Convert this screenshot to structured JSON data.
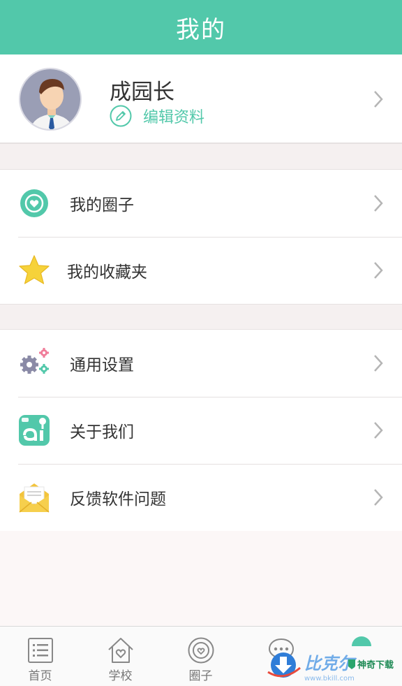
{
  "header": {
    "title": "我的"
  },
  "profile": {
    "name": "成园长",
    "edit_label": "编辑资料"
  },
  "menu_group_1": [
    {
      "label": "我的圈子",
      "icon": "circle-heart-icon"
    },
    {
      "label": "我的收藏夹",
      "icon": "star-icon"
    }
  ],
  "menu_group_2": [
    {
      "label": "通用设置",
      "icon": "gears-icon"
    },
    {
      "label": "关于我们",
      "icon": "app-logo-icon"
    },
    {
      "label": "反馈软件问题",
      "icon": "envelope-icon"
    }
  ],
  "tabbar": {
    "tabs": [
      {
        "label": "首页",
        "icon": "list-icon"
      },
      {
        "label": "学校",
        "icon": "house-heart-icon"
      },
      {
        "label": "圈子",
        "icon": "circle-heart-icon"
      },
      {
        "label": "",
        "icon": "chat-bubble-icon"
      },
      {
        "label": "",
        "icon": "profile-icon"
      }
    ]
  },
  "watermark": {
    "text": "比克尔",
    "url_text": "www.bkill.com",
    "brand": "神奇下载"
  },
  "colors": {
    "accent": "#52c8aa",
    "star": "#f6d23a",
    "envelope": "#f3c43c",
    "gear": "#8a8aa6",
    "pink": "#f07d9a"
  }
}
